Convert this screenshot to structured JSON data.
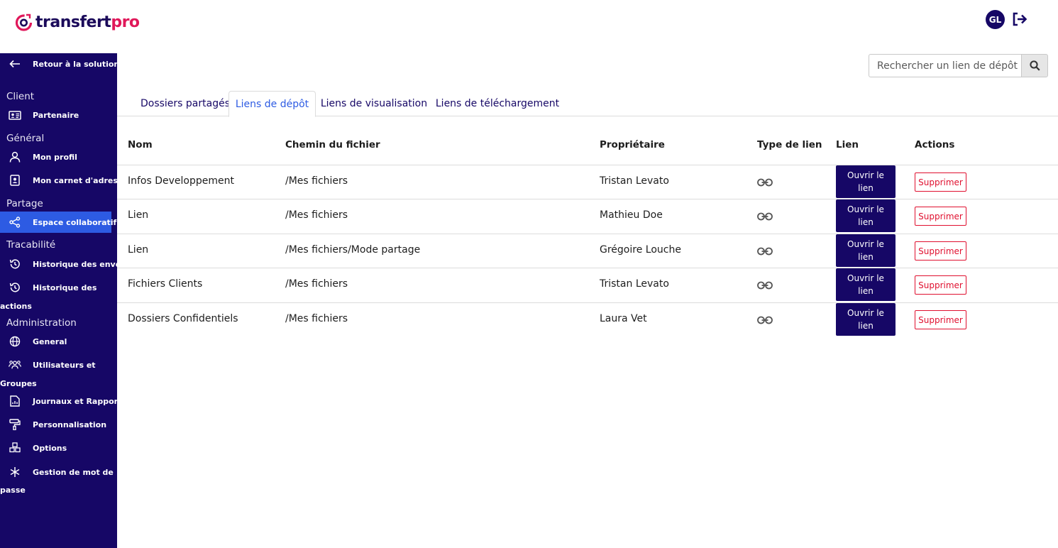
{
  "header": {
    "logo_part1": "transfert",
    "logo_part2": "pro",
    "avatar_initials": "GL",
    "brand_color": "#160766",
    "accent_color": "#e0185a"
  },
  "sidebar": {
    "back_label": "Retour à la solution",
    "sections": {
      "client": "Client",
      "general": "Général",
      "partage": "Partage",
      "tracabilite": "Tracabilité",
      "administration": "Administration"
    },
    "items": {
      "partenaire": "Partenaire",
      "mon_profil": "Mon profil",
      "carnet": "Mon carnet d'adresse",
      "espace": "Espace collaboratif",
      "hist_envois": "Historique des envois",
      "hist_actions_1": "Historique des",
      "hist_actions_2": "actions",
      "general": "General",
      "users_1": "Utilisateurs et",
      "users_2": "Groupes",
      "journaux": "Journaux et Rapports",
      "perso": "Personnalisation",
      "options": "Options",
      "mdp_1": "Gestion de mot de",
      "mdp_2": "passe"
    }
  },
  "search": {
    "placeholder": "Rechercher un lien de dépôt"
  },
  "tabs": [
    "Dossiers partagés",
    "Liens de dépôt",
    "Liens de visualisation",
    "Liens de téléchargement"
  ],
  "table": {
    "headers": [
      "Nom",
      "Chemin du fichier",
      "Propriétaire",
      "Type de lien",
      "Lien",
      "Actions"
    ],
    "open_label": "Ouvrir le lien",
    "delete_label": "Supprimer",
    "rows": [
      {
        "nom": "Infos Developpement",
        "chemin": "/Mes fichiers",
        "proprietaire": "Tristan Levato"
      },
      {
        "nom": "Lien",
        "chemin": "/Mes fichiers",
        "proprietaire": "Mathieu Doe"
      },
      {
        "nom": "Lien",
        "chemin": "/Mes fichiers/Mode partage",
        "proprietaire": "Grégoire Louche"
      },
      {
        "nom": "Fichiers Clients",
        "chemin": "/Mes fichiers",
        "proprietaire": "Tristan Levato"
      },
      {
        "nom": "Dossiers Confidentiels",
        "chemin": "/Mes fichiers",
        "proprietaire": "Laura Vet"
      }
    ]
  }
}
